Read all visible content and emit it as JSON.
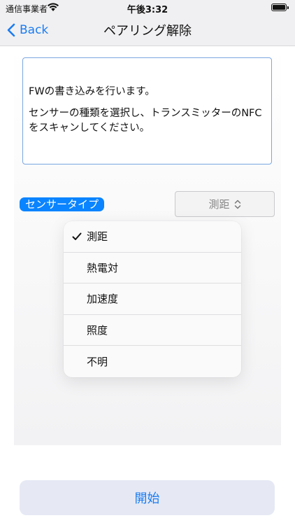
{
  "status_bar": {
    "carrier": "通信事業者",
    "time": "午後3:32"
  },
  "nav": {
    "back_label": "Back",
    "title": "ペアリング解除"
  },
  "info": {
    "line1": "FWの書き込みを行います。",
    "line2": "センサーの種類を選択し、トランスミッターのNFCをスキャンしてください。"
  },
  "sensor": {
    "label": "センサータイプ",
    "selected": "測距",
    "options": [
      "測距",
      "熱電対",
      "加速度",
      "照度",
      "不明"
    ]
  },
  "start_button": "開始",
  "colors": {
    "accent": "#1a7cf2",
    "label_bg": "#0a84ff"
  }
}
